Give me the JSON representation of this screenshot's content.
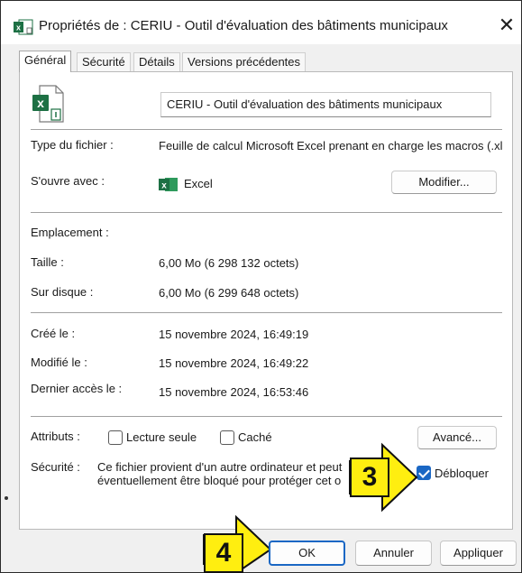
{
  "window": {
    "title": "Propriétés de : CERIU - Outil d'évaluation des bâtiments municipaux",
    "close_glyph": "✕"
  },
  "tabs": [
    {
      "label": "Général",
      "active": true
    },
    {
      "label": "Sécurité",
      "active": false
    },
    {
      "label": "Détails",
      "active": false
    },
    {
      "label": "Versions précédentes",
      "active": false
    }
  ],
  "general": {
    "file_name": "CERIU - Outil d'évaluation des bâtiments municipaux",
    "file_type_label": "Type du fichier :",
    "file_type_value": "Feuille de calcul Microsoft Excel prenant en charge les macros (.xl",
    "opens_with_label": "S'ouvre avec :",
    "opens_with_value": "Excel",
    "change_button": "Modifier...",
    "location_label": "Emplacement :",
    "size_label": "Taille :",
    "size_value": "6,00 Mo (6 298 132 octets)",
    "size_on_disk_label": "Sur disque :",
    "size_on_disk_value": "6,00 Mo (6 299 648 octets)",
    "created_label": "Créé le :",
    "created_value": "15 novembre 2024, 16:49:19",
    "modified_label": "Modifié le :",
    "modified_value": "15 novembre 2024, 16:49:22",
    "accessed_label": "Dernier accès le :",
    "accessed_value": "15 novembre 2024, 16:53:46",
    "attributes_label": "Attributs :",
    "readonly_label": "Lecture seule",
    "readonly_checked": false,
    "hidden_label": "Caché",
    "hidden_checked": false,
    "advanced_button": "Avancé...",
    "security_label": "Sécurité :",
    "security_line1": "Ce fichier provient d'un autre ordinateur et peut",
    "security_line2": "éventuellement être bloqué pour protéger cet o",
    "unblock_label": "Débloquer",
    "unblock_checked": true
  },
  "footer": {
    "ok": "OK",
    "cancel": "Annuler",
    "apply": "Appliquer"
  },
  "callouts": [
    {
      "number": "3",
      "color": "#ffee10"
    },
    {
      "number": "4",
      "color": "#ffee10"
    }
  ],
  "colors": {
    "excel_green": "#1d7044",
    "accent_blue": "#1a67c4",
    "callout_yellow": "#ffee10"
  },
  "icons": [
    "excel-file-icon",
    "excel-app-icon",
    "close-icon",
    "check-icon",
    "arrow-right-icon"
  ]
}
